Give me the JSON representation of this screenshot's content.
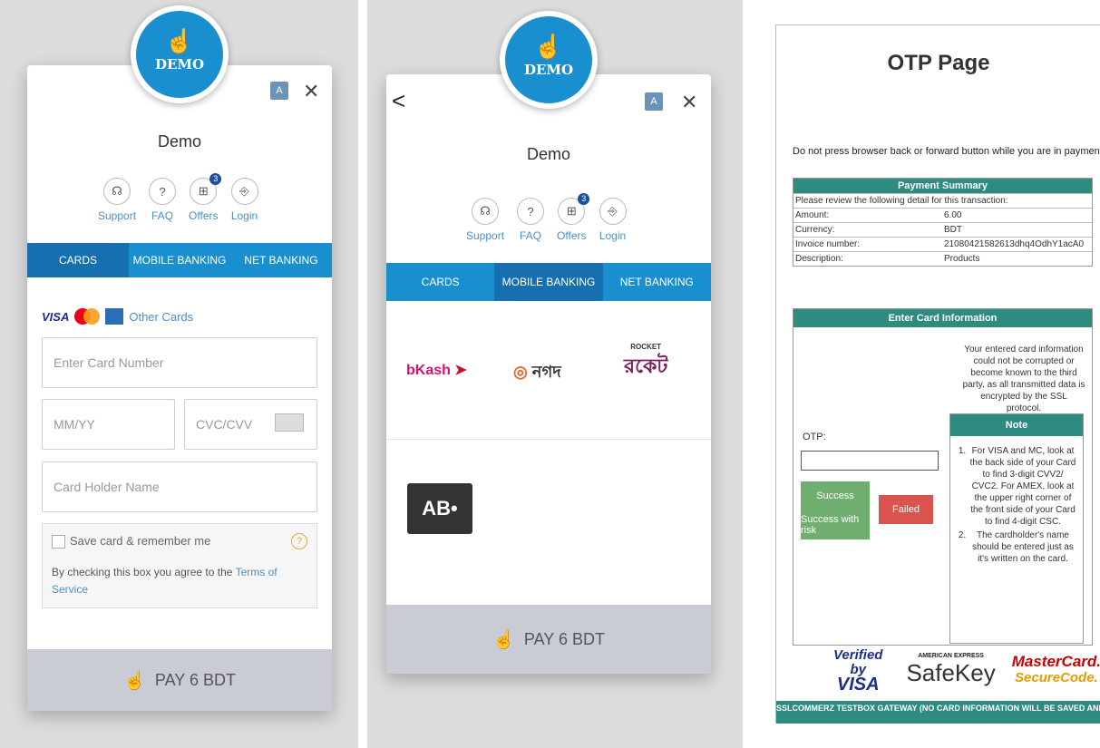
{
  "panel1": {
    "logo_text": "DEMO",
    "merchant_name": "Demo",
    "quick_links": [
      {
        "label": "Support",
        "icon": "headset-icon"
      },
      {
        "label": "FAQ",
        "icon": "question-icon"
      },
      {
        "label": "Offers",
        "icon": "gift-icon",
        "badge": "3"
      },
      {
        "label": "Login",
        "icon": "login-icon"
      }
    ],
    "tabs": [
      "CARDS",
      "MOBILE BANKING",
      "NET BANKING"
    ],
    "active_tab": "CARDS",
    "brands": {
      "visa": "VISA",
      "other": "Other Cards"
    },
    "card_number_placeholder": "Enter Card Number",
    "expiry_placeholder": "MM/YY",
    "cvc_placeholder": "CVC/CVV",
    "holder_placeholder": "Card Holder Name",
    "save_label": "Save card & remember me",
    "agree_text": "By checking this box you agree to the ",
    "terms_link": "Terms of Service",
    "help_glyph": "?",
    "pay_label": "PAY 6 BDT"
  },
  "panel2": {
    "back_glyph": "<",
    "logo_text": "DEMO",
    "merchant_name": "Demo",
    "quick_links": [
      {
        "label": "Support",
        "icon": "headset-icon"
      },
      {
        "label": "FAQ",
        "icon": "question-icon"
      },
      {
        "label": "Offers",
        "icon": "gift-icon",
        "badge": "3"
      },
      {
        "label": "Login",
        "icon": "login-icon"
      }
    ],
    "tabs": [
      "CARDS",
      "MOBILE BANKING",
      "NET BANKING"
    ],
    "active_tab": "MOBILE BANKING",
    "methods": [
      "bKash",
      "নগদ",
      "রকেট",
      "AB•"
    ],
    "rocket_small": "ROCKET",
    "pay_label": "PAY 6 BDT"
  },
  "otp": {
    "title": "OTP Page",
    "warning": "Do not press browser back or forward button while you are in payment page",
    "summary_title": "Payment Summary",
    "summary_intro": "Please review the following detail for this transaction:",
    "rows": [
      {
        "k": "Amount:",
        "v": "6.00"
      },
      {
        "k": "Currency:",
        "v": "BDT"
      },
      {
        "k": "Invoice number:",
        "v": "21080421582613dhq4OdhY1acA0"
      },
      {
        "k": "Description:",
        "v": "Products"
      }
    ],
    "card_title": "Enter Card Information",
    "info_text": "Your entered card information could not be corrupted or become known to the third party, as all transmitted data is encrypted by the SSL protocol.",
    "otp_label": "OTP:",
    "success_label": "Success",
    "risk_label": "Success with risk",
    "failed_label": "Failed",
    "note_title": "Note",
    "note_1": "For VISA and MC, look at the back side of your Card to find 3-digit CVV2/ CVC2. For AMEX, look at the upper right corner of the front side of your Card to find 4-digit CSC.",
    "note_2": "The cardholder's name should be entered just as it's written on the card.",
    "logos": {
      "verified_by": "Verified by",
      "visa": "VISA",
      "amex": "AMERICAN EXPRESS",
      "safekey": "SafeKey",
      "mastercard": "MasterCard.",
      "securecode": "SecureCode."
    },
    "footer": "SSLCOMMERZ TESTBOX GATEWAY (NO CARD INFORMATION WILL BE SAVED AND DUMMY CARD WILL BE DISPLAYED IN REPORT)"
  },
  "colors": {
    "primary": "#1a8fd0",
    "active_tab": "#1670b0",
    "teal": "#2e8b80",
    "success": "#6fae6f",
    "failed": "#d9534f"
  }
}
